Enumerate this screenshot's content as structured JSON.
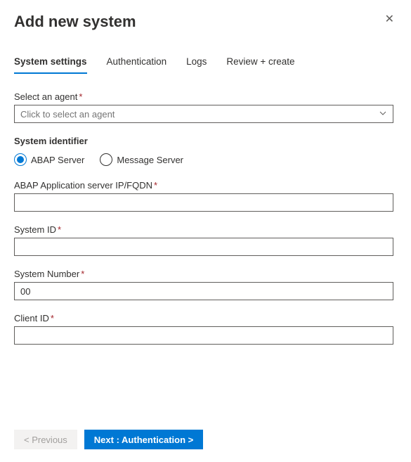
{
  "header": {
    "title": "Add new system",
    "close_icon": "✕"
  },
  "tabs": [
    {
      "label": "System settings",
      "active": true
    },
    {
      "label": "Authentication",
      "active": false
    },
    {
      "label": "Logs",
      "active": false
    },
    {
      "label": "Review + create",
      "active": false
    }
  ],
  "form": {
    "select_agent": {
      "label": "Select an agent",
      "placeholder": "Click to select an agent",
      "value": ""
    },
    "system_identifier": {
      "label": "System identifier",
      "options": [
        {
          "label": "ABAP Server",
          "checked": true
        },
        {
          "label": "Message Server",
          "checked": false
        }
      ]
    },
    "abap_server": {
      "label": "ABAP Application server IP/FQDN",
      "value": ""
    },
    "system_id": {
      "label": "System ID",
      "value": ""
    },
    "system_number": {
      "label": "System Number",
      "value": "00"
    },
    "client_id": {
      "label": "Client ID",
      "value": ""
    }
  },
  "footer": {
    "previous": "< Previous",
    "next": "Next : Authentication  >"
  }
}
